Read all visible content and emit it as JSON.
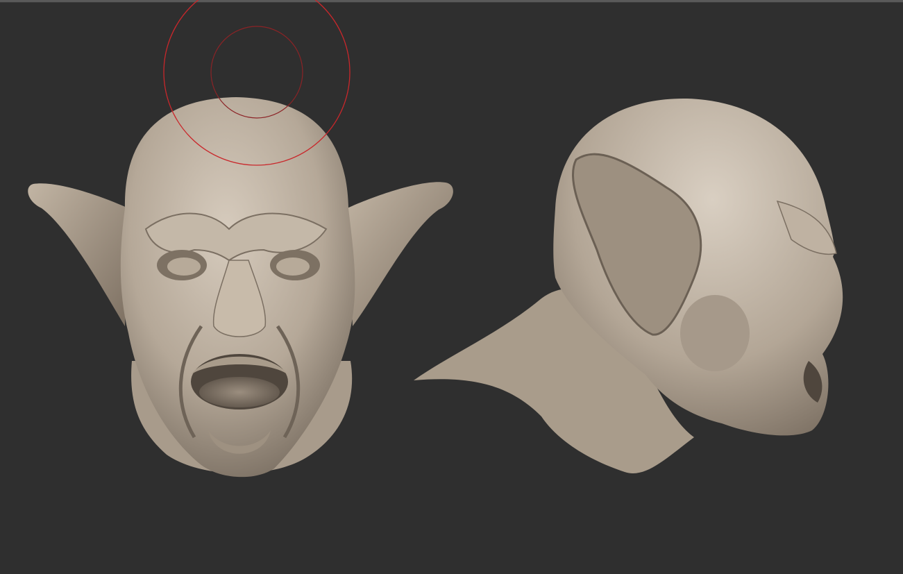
{
  "app": {
    "view": "sculpt-viewport",
    "background_color": "#2f2f2f",
    "mesh_color": "#b9ac9c",
    "brush_cursor_color": "#d4252a"
  },
  "models": [
    {
      "name": "goblin-head-front"
    },
    {
      "name": "goblin-head-side"
    }
  ],
  "brush_cursor": {
    "outer_ring": "draw-size",
    "inner_ring": "focal-shift"
  }
}
